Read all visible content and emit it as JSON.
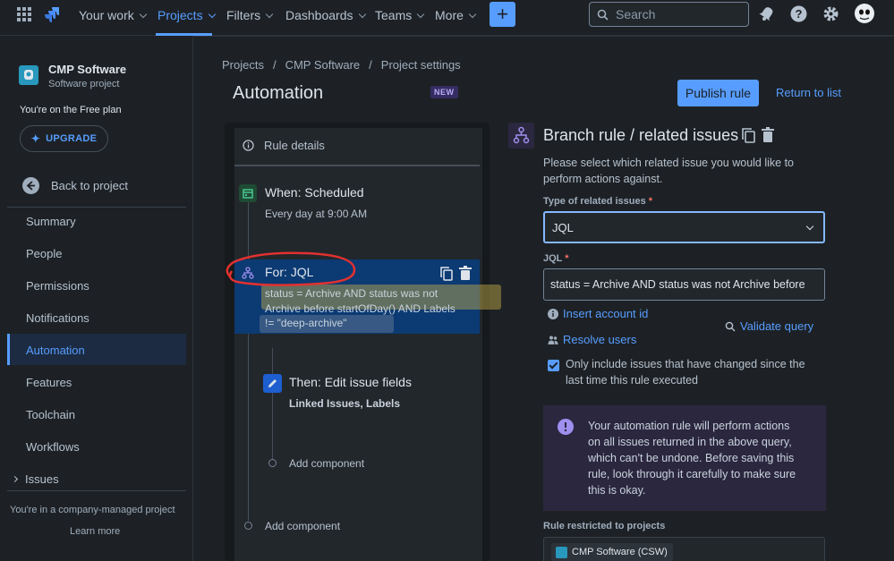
{
  "topnav": {
    "your_work": "Your work",
    "projects": "Projects",
    "filters": "Filters",
    "dashboards": "Dashboards",
    "teams": "Teams",
    "more": "More",
    "create": "+",
    "search_placeholder": "Search"
  },
  "sidebar": {
    "project_name": "CMP Software",
    "project_type": "Software project",
    "plan_text": "You're on the Free plan",
    "upgrade_label": "UPGRADE",
    "back_label": "Back to project",
    "items": [
      {
        "label": "Summary"
      },
      {
        "label": "People"
      },
      {
        "label": "Permissions"
      },
      {
        "label": "Notifications"
      },
      {
        "label": "Automation"
      },
      {
        "label": "Features"
      },
      {
        "label": "Toolchain"
      },
      {
        "label": "Workflows"
      },
      {
        "label": "Issues"
      }
    ],
    "footer_text": "You're in a company-managed project",
    "learn_more": "Learn more"
  },
  "breadcrumb": {
    "projects": "Projects",
    "project": "CMP Software",
    "settings": "Project settings",
    "sep": "/"
  },
  "page": {
    "title": "Automation",
    "badge": "NEW",
    "publish_label": "Publish rule",
    "return_label": "Return to list"
  },
  "rule": {
    "details_label": "Rule details",
    "trigger_title": "When: Scheduled",
    "trigger_desc": "Every day at 9:00 AM",
    "branch_title": "For: JQL",
    "branch_jql_1": "status = Archive AND status was not",
    "branch_jql_2": "Archive before startOfDay() AND Labels",
    "branch_jql_3": "!= \"deep-archive\"",
    "action_title": "Then: Edit issue fields",
    "action_desc": "Linked Issues, Labels",
    "add_component_inner": "Add component",
    "add_component_outer": "Add component"
  },
  "config": {
    "title": "Branch rule / related issues",
    "desc_1": "Please select which related issue you would like to",
    "desc_2": "perform actions against.",
    "type_label": "Type of related issues",
    "required_mark": "*",
    "type_value": "JQL",
    "jql_label": "JQL",
    "jql_value": "status = Archive AND status was not Archive before",
    "insert_account": "Insert account id",
    "validate_query": "Validate query",
    "resolve_users": "Resolve users",
    "checkbox_1": "Only include issues that have changed since the",
    "checkbox_2": "last time this rule executed",
    "warning_1": "Your automation rule will perform actions",
    "warning_2": "on all issues returned in the above query,",
    "warning_3": "which can't be undone. Before saving this",
    "warning_4": "rule, look through it carefully to make sure",
    "warning_5": "this is okay.",
    "restricted_label": "Rule restricted to projects",
    "project_chip": "CMP Software (CSW)"
  },
  "colors": {
    "accent": "#579dff",
    "background": "#1d2125",
    "highlight_block": "#0c3a73",
    "annotation_red": "#e2312f",
    "annotation_yellow": "#c9b24a"
  }
}
